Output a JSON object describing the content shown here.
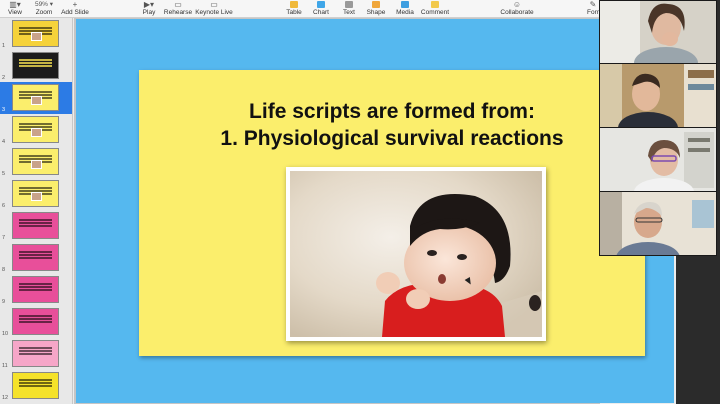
{
  "toolbar": {
    "view_label": "View",
    "zoom_label": "Zoom",
    "zoom_value": "59%",
    "add_slide_label": "Add Slide",
    "play_label": "Play",
    "rehearse_label": "Rehearse",
    "keynote_live_label": "Keynote Live",
    "table_label": "Table",
    "chart_label": "Chart",
    "text_label": "Text",
    "shape_label": "Shape",
    "media_label": "Media",
    "comment_label": "Comment",
    "collaborate_label": "Collaborate",
    "format_label": "Forr"
  },
  "navigator": {
    "slides": [
      {
        "number": "1",
        "color": "#f5d23a",
        "selected": false,
        "picture": true
      },
      {
        "number": "2",
        "color": "#1c1c1c",
        "selected": false,
        "picture": false
      },
      {
        "number": "3",
        "color": "#fbee6c",
        "selected": true,
        "picture": true
      },
      {
        "number": "4",
        "color": "#fbee6c",
        "selected": false,
        "picture": true
      },
      {
        "number": "5",
        "color": "#fbee6c",
        "selected": false,
        "picture": true
      },
      {
        "number": "6",
        "color": "#fbee6c",
        "selected": false,
        "picture": true
      },
      {
        "number": "7",
        "color": "#e84f9a",
        "selected": false,
        "picture": false
      },
      {
        "number": "8",
        "color": "#e84f9a",
        "selected": false,
        "picture": false
      },
      {
        "number": "9",
        "color": "#e84f9a",
        "selected": false,
        "picture": false
      },
      {
        "number": "10",
        "color": "#e84f9a",
        "selected": false,
        "picture": false
      },
      {
        "number": "11",
        "color": "#f6a6c8",
        "selected": false,
        "picture": false
      },
      {
        "number": "12",
        "color": "#f5e22a",
        "selected": false,
        "picture": false
      }
    ]
  },
  "slide": {
    "title_line1": "Life scripts are formed from:",
    "title_line2": "1. Physiological survival reactions",
    "outer_color": "#55b8ef",
    "inner_color": "#fbee6c"
  },
  "colors": {
    "selection": "#2c7be5",
    "toolbar_bg": "#f6f6f6"
  }
}
